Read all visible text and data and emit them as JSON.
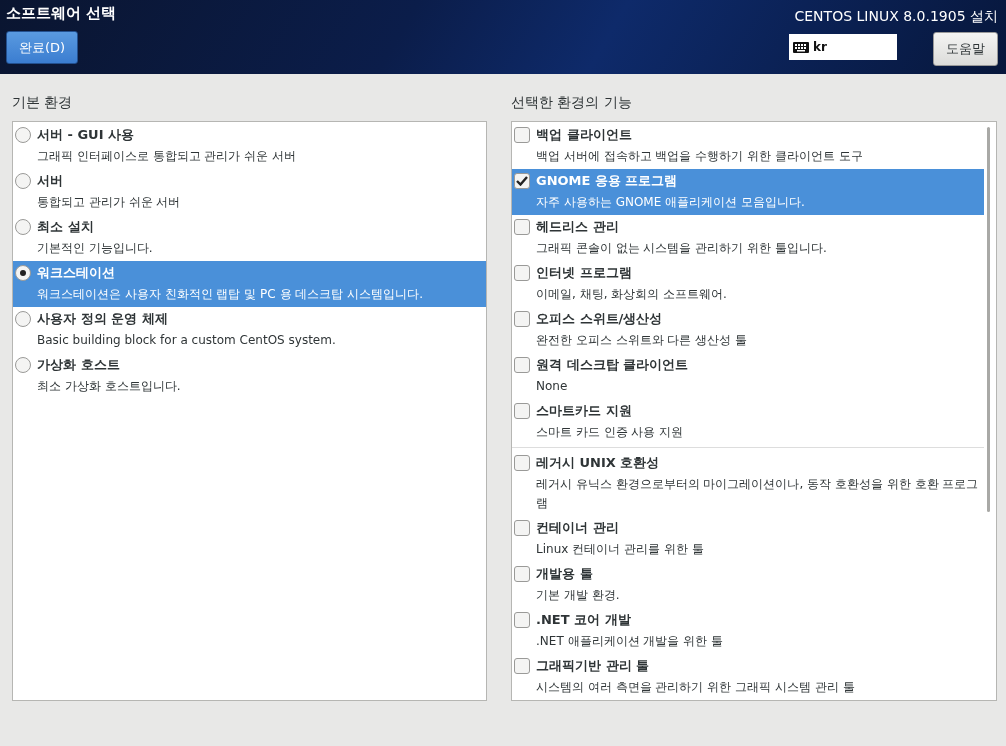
{
  "header": {
    "title": "소프트웨어 선택",
    "done_button": "완료(D)",
    "product": "CENTOS LINUX 8.0.1905 설치",
    "keyboard_layout": "kr",
    "help_button": "도움말"
  },
  "base_environment": {
    "heading": "기본 환경",
    "items": [
      {
        "title": "서버 - GUI 사용",
        "description": "그래픽 인터페이스로 통합되고 관리가 쉬운 서버",
        "selected": false
      },
      {
        "title": "서버",
        "description": "통합되고 관리가 쉬운 서버",
        "selected": false
      },
      {
        "title": "최소 설치",
        "description": "기본적인 기능입니다.",
        "selected": false
      },
      {
        "title": "워크스테이션",
        "description": "워크스테이션은 사용자 친화적인 랩탑 및 PC 용 데스크탑 시스템입니다.",
        "selected": true
      },
      {
        "title": "사용자 정의 운영 체제",
        "description": "Basic building block for a custom CentOS system.",
        "selected": false
      },
      {
        "title": "가상화 호스트",
        "description": "최소 가상화 호스트입니다.",
        "selected": false
      }
    ]
  },
  "addons": {
    "heading": "선택한 환경의 기능",
    "groups": [
      {
        "items": [
          {
            "title": "백업 클라이언트",
            "description": "백업 서버에 접속하고 백업을 수행하기 위한 클라이언트 도구",
            "checked": false,
            "selected": false
          },
          {
            "title": "GNOME 응용 프로그램",
            "description": "자주 사용하는 GNOME 애플리케이션 모음입니다.",
            "checked": true,
            "selected": true
          },
          {
            "title": "헤드리스 관리",
            "description": "그래픽 콘솔이 없는 시스템을 관리하기 위한 툴입니다.",
            "checked": false,
            "selected": false
          },
          {
            "title": "인터넷 프로그램",
            "description": "이메일, 채팅, 화상회의 소프트웨어.",
            "checked": false,
            "selected": false
          },
          {
            "title": "오피스 스위트/생산성",
            "description": "완전한 오피스 스위트와 다른 생산성 툴",
            "checked": false,
            "selected": false
          },
          {
            "title": "원격 데스크탑 클라이언트",
            "description": "None",
            "checked": false,
            "selected": false
          },
          {
            "title": "스마트카드 지원",
            "description": "스마트 카드 인증 사용 지원",
            "checked": false,
            "selected": false
          }
        ]
      },
      {
        "items": [
          {
            "title": "레거시 UNIX 호환성",
            "description": "레거시 유닉스 환경으로부터의 마이그레이션이나, 동작 호환성을 위한 호환 프로그램",
            "checked": false,
            "selected": false
          },
          {
            "title": "컨테이너 관리",
            "description": "Linux 컨테이너 관리를 위한 툴",
            "checked": false,
            "selected": false
          },
          {
            "title": "개발용 툴",
            "description": "기본 개발 환경.",
            "checked": false,
            "selected": false
          },
          {
            "title": ".NET 코어 개발",
            "description": ".NET 애플리케이션 개발을 위한 툴",
            "checked": false,
            "selected": false
          },
          {
            "title": "그래픽기반 관리 툴",
            "description": "시스템의 여러 측면을 관리하기 위한 그래픽 시스템 관리 툴",
            "checked": false,
            "selected": false
          }
        ]
      }
    ]
  }
}
